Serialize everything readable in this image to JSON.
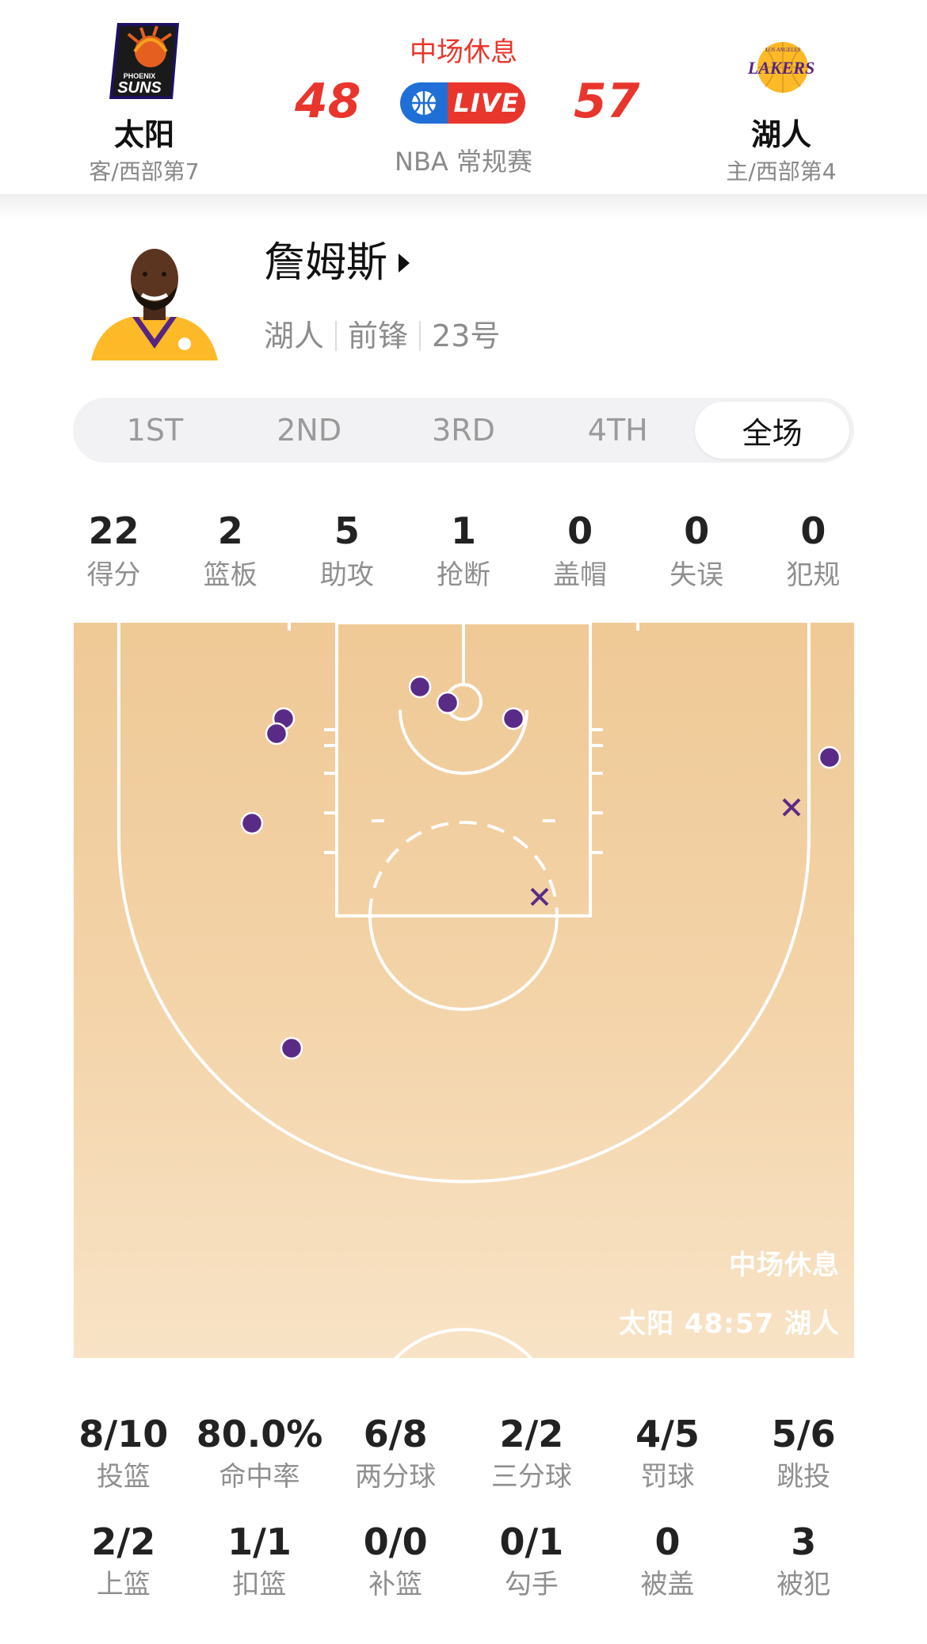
{
  "header": {
    "status": "中场休息",
    "league": "NBA 常规赛",
    "live_label": "LIVE",
    "away": {
      "name": "太阳",
      "sub": "客/西部第7",
      "score": "48",
      "logo_text": "SUNS",
      "logo_small": "PHOENIX"
    },
    "home": {
      "name": "湖人",
      "sub": "主/西部第4",
      "score": "57",
      "logo_text": "LAKERS",
      "logo_small": "LOS ANGELES"
    }
  },
  "player": {
    "name": "詹姆斯",
    "team": "湖人",
    "position": "前锋",
    "number": "23号"
  },
  "tabs": [
    {
      "label": "1ST",
      "active": false
    },
    {
      "label": "2ND",
      "active": false
    },
    {
      "label": "3RD",
      "active": false
    },
    {
      "label": "4TH",
      "active": false
    },
    {
      "label": "全场",
      "active": true
    }
  ],
  "stats": [
    {
      "value": "22",
      "label": "得分"
    },
    {
      "value": "2",
      "label": "篮板"
    },
    {
      "value": "5",
      "label": "助攻"
    },
    {
      "value": "1",
      "label": "抢断"
    },
    {
      "value": "0",
      "label": "盖帽"
    },
    {
      "value": "0",
      "label": "失误"
    },
    {
      "value": "0",
      "label": "犯规"
    }
  ],
  "court": {
    "overlay_status": "中场休息",
    "overlay_score": "太阳 48:57 湖人",
    "colors": {
      "made": "#5a2b86",
      "missed": "#5a2b86",
      "lines": "#ffffff"
    }
  },
  "shooting_row1": [
    {
      "value": "8/10",
      "label": "投篮"
    },
    {
      "value": "80.0%",
      "label": "命中率"
    },
    {
      "value": "6/8",
      "label": "两分球"
    },
    {
      "value": "2/2",
      "label": "三分球"
    },
    {
      "value": "4/5",
      "label": "罚球"
    },
    {
      "value": "5/6",
      "label": "跳投"
    }
  ],
  "shooting_row2": [
    {
      "value": "2/2",
      "label": "上篮"
    },
    {
      "value": "1/1",
      "label": "扣篮"
    },
    {
      "value": "0/0",
      "label": "补篮"
    },
    {
      "value": "0/1",
      "label": "勾手"
    },
    {
      "value": "0",
      "label": "被盖"
    },
    {
      "value": "3",
      "label": "被犯"
    }
  ]
}
